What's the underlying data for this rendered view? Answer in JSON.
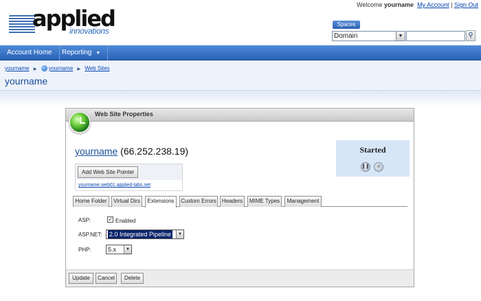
{
  "header": {
    "welcome_prefix": "Welcome",
    "username": "yourname",
    "my_account": "My Account",
    "separator": "|",
    "sign_out": "Sign Out",
    "logo": {
      "brand": "applied",
      "sub": "innovations"
    },
    "spaces_label": "Spaces",
    "domain_select_value": "Domain",
    "search_placeholder": ""
  },
  "nav": {
    "items": [
      {
        "label": "Account Home"
      },
      {
        "label": "Reporting"
      }
    ]
  },
  "breadcrumb": {
    "items": [
      "yourname",
      "yourname",
      "Web Sites"
    ]
  },
  "page_title": "yourname",
  "panel": {
    "title": "Web Site Properties",
    "site_name": "yourname",
    "site_ip": "(66.252.238.19)",
    "add_pointer_label": "Add Web Site Pointer",
    "pointer_link": "yourname.web01.applied-labs.net",
    "status": "Started",
    "tabs": [
      {
        "label": "Home Folder"
      },
      {
        "label": "Virtual Dirs"
      },
      {
        "label": "Extensions",
        "active": true
      },
      {
        "label": "Custom Errors"
      },
      {
        "label": "Headers"
      },
      {
        "label": "MIME Types"
      },
      {
        "label": "Management"
      }
    ],
    "form": {
      "asp_label": "ASP:",
      "asp_enabled_label": "Enabled",
      "asp_enabled": true,
      "aspnet_label": "ASP.NET:",
      "aspnet_value": "2.0 Integrated Pipeline",
      "php_label": "PHP:",
      "php_value": "5.x"
    },
    "buttons": {
      "update": "Update",
      "cancel": "Cancel",
      "delete": "Delete"
    }
  },
  "colors": {
    "nav_blue": "#2a62b8",
    "link_blue": "#0645ad",
    "status_bg": "#d7e6f7"
  }
}
